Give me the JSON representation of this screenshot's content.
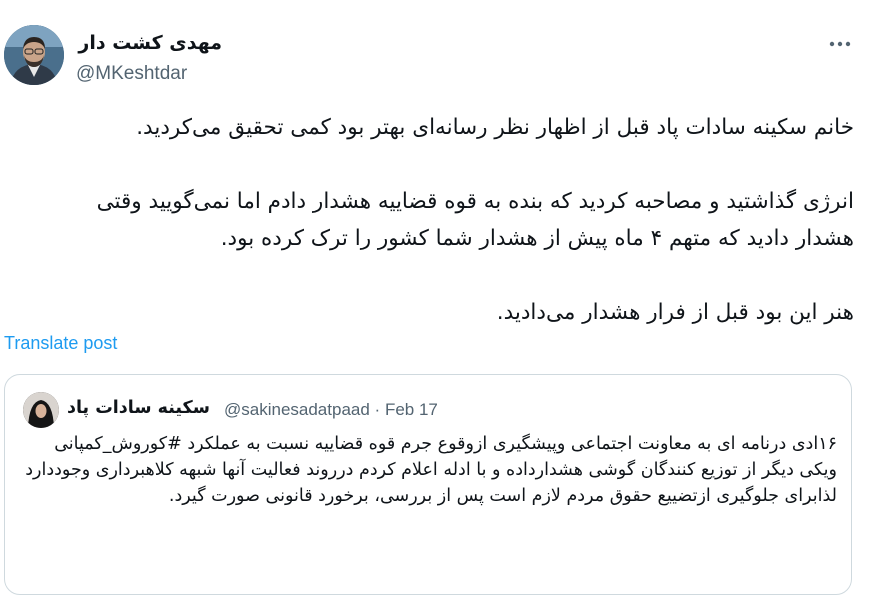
{
  "tweet": {
    "author_name": "مهدی کشت دار",
    "author_handle": "@MKeshtdar",
    "more_icon": "more-dots-icon",
    "lines": [
      "خانم سکینه سادات پاد قبل از اظهار نظر رسانه‌ای بهتر بود کمی تحقیق می‌کردید.",
      "انرژی گذاشتید و مصاحبه کردید که بنده به قوه قضاییه هشدار دادم اما نمی‌گویید وقتی هشدار دادید که متهم ۴ ماه پیش از هشدار شما کشور را ترک کرده بود.",
      "هنر این بود قبل از فرار هشدار می‌دادید."
    ],
    "translate_label": "Translate post"
  },
  "quote": {
    "author_name": "سکینه سادات پاد",
    "author_handle": "@sakinesadatpaad",
    "separator": "·",
    "date": "Feb 17",
    "text": "۱۶ادی درنامه ای به معاونت اجتماعی وپیشگیری ازوقوع جرم قوه قضاییه نسبت به عملکرد #کوروش_کمپانی ویکی دیگر از توزیع کنندگان گوشی هشدارداده و با ادله اعلام کردم درروند فعالیت آنها شبهه کلاهبرداری وجوددارد لذابرای جلوگیری ازتضییع حقوق مردم لازم است پس از بررسی، برخورد قانونی صورت گیرد."
  }
}
